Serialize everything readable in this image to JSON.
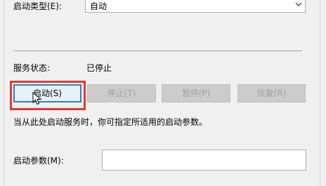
{
  "startup_type": {
    "label": "启动类型(E):",
    "selected_value": "自动"
  },
  "service_status": {
    "label": "服务状态:",
    "value": "已停止"
  },
  "buttons": {
    "start": "启动(S)",
    "stop": "停止(T)",
    "pause": "暂停(P)",
    "resume": "恢复(R)"
  },
  "hint": "当从此处启动服务时，你可指定所适用的启动参数。",
  "start_params": {
    "label": "启动参数(M):",
    "value": ""
  },
  "colors": {
    "highlight": "#e53935",
    "focus_border": "#3c7fb1"
  }
}
